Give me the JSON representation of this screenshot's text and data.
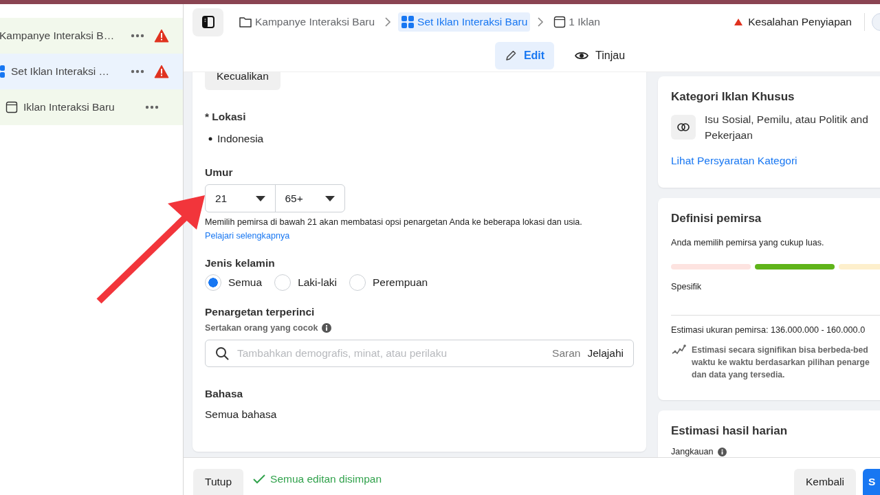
{
  "sidebar": {
    "items": [
      {
        "label": "Kampanye Interaksi B…",
        "kind": "campaign",
        "selected": false,
        "warning": true
      },
      {
        "label": "Set Iklan Interaksi …",
        "kind": "adset",
        "selected": true,
        "warning": true
      },
      {
        "label": "Iklan Interaksi Baru",
        "kind": "ad",
        "selected": false,
        "warning": false
      }
    ]
  },
  "header": {
    "breadcrumbs": [
      {
        "label": "Kampanye Interaksi Baru",
        "kind": "campaign",
        "selected": false
      },
      {
        "label": "Set Iklan Interaksi Baru",
        "kind": "adset",
        "selected": true
      },
      {
        "label": "1 Iklan",
        "kind": "ad",
        "selected": false
      }
    ],
    "status": {
      "label": "Kesalahan Penyiapan",
      "kind": "error"
    }
  },
  "mode_tabs": [
    {
      "label": "Edit",
      "kind": "edit",
      "selected": true
    },
    {
      "label": "Tinjau",
      "kind": "review",
      "selected": false
    }
  ],
  "form": {
    "exclude_button": "Kecualikan",
    "location": {
      "label": "* Lokasi",
      "values": [
        "Indonesia"
      ]
    },
    "age": {
      "label": "Umur",
      "min": "21",
      "max": "65+",
      "note": "Memilih pemirsa di bawah 21 akan membatasi opsi penargetan Anda ke beberapa lokasi dan usia.",
      "link": "Pelajari selengkapnya"
    },
    "gender": {
      "label": "Jenis kelamin",
      "options": [
        {
          "label": "Semua",
          "selected": true
        },
        {
          "label": "Laki-laki",
          "selected": false
        },
        {
          "label": "Perempuan",
          "selected": false
        }
      ]
    },
    "detailed": {
      "label": "Penargetan terperinci",
      "sublabel": "Sertakan orang yang cocok",
      "placeholder": "Tambahkan demografis, minat, atau perilaku",
      "actions": [
        "Saran",
        "Jelajahi"
      ]
    },
    "language": {
      "label": "Bahasa",
      "value": "Semua bahasa"
    }
  },
  "special_category": {
    "title": "Kategori Iklan Khusus",
    "text": "Isu Sosial, Pemilu, atau Politik and Pekerjaan",
    "link": "Lihat Persyaratan Kategori"
  },
  "audience": {
    "title": "Definisi pemirsa",
    "summary": "Anda memilih pemirsa yang cukup luas.",
    "segments": [
      {
        "color": "#fde3e0"
      },
      {
        "color": "#5fb41a"
      },
      {
        "color": "#fdefcc"
      }
    ],
    "scale_label": "Spesifik",
    "size": "Estimasi ukuran pemirsa: 136.000.000 - 160.000.0",
    "note_lines": [
      "Estimasi secara signifikan bisa berbeda-bed",
      "waktu ke waktu berdasarkan pilihan penarge",
      "dan data yang tersedia."
    ]
  },
  "daily_results": {
    "title": "Estimasi hasil harian",
    "metric": "Jangkauan"
  },
  "footer": {
    "close_button": "Tutup",
    "saved": "Semua editan disimpan",
    "back_button": "Kembali",
    "next_button": "S"
  }
}
